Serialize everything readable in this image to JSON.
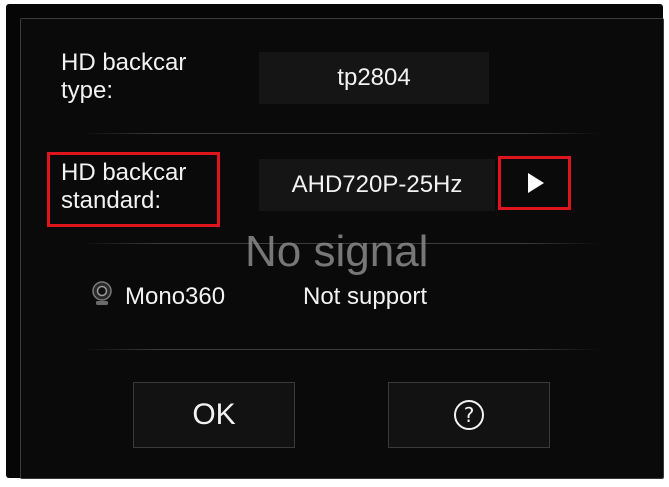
{
  "type_row": {
    "label": "HD backcar\ntype:",
    "value": "tp2804"
  },
  "standard_row": {
    "label": "HD backcar\nstandard:",
    "value": "AHD720P-25Hz",
    "next_icon": "play-icon"
  },
  "overlay": {
    "text": "No signal"
  },
  "mono_row": {
    "icon": "camera-icon",
    "label": "Mono360",
    "status": "Not support"
  },
  "buttons": {
    "ok_label": "OK",
    "help_glyph": "?"
  },
  "colors": {
    "highlight": "#e0141c",
    "background": "#0a0a0a",
    "text": "#f2f2f2"
  }
}
